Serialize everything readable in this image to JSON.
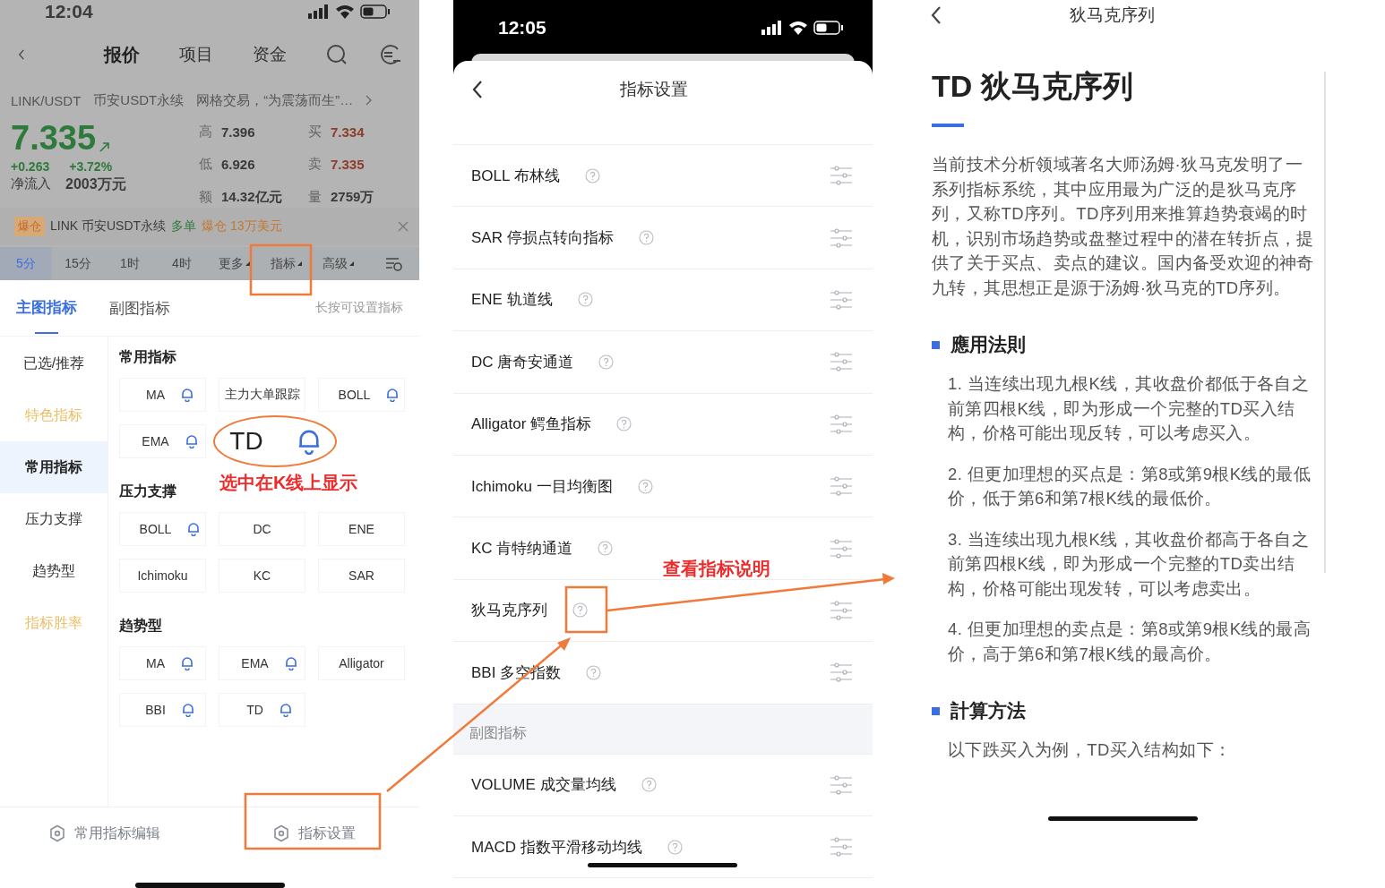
{
  "left_screen": {
    "status_bar": {
      "time": "12:04"
    },
    "nav_tabs": [
      {
        "label": "报价",
        "selected": true
      },
      {
        "label": "项目",
        "selected": false
      },
      {
        "label": "资金",
        "selected": false
      }
    ],
    "ticker": {
      "pair": "LINK/USDT",
      "market": "币安USDT永续",
      "promo": "网格交易，“为震荡而生”…"
    },
    "quote": {
      "price": "7.335",
      "change": "+0.263",
      "change_pct": "+3.72%",
      "net_inflow_label": "净流入",
      "net_inflow": "2003万元",
      "stats": [
        {
          "label": "高",
          "value": "7.396",
          "kind": "plain"
        },
        {
          "label": "买",
          "value": "7.334",
          "kind": "bid"
        },
        {
          "label": "低",
          "value": "6.926",
          "kind": "plain"
        },
        {
          "label": "卖",
          "value": "7.335",
          "kind": "bid"
        },
        {
          "label": "额",
          "value": "14.32亿元",
          "kind": "plain"
        },
        {
          "label": "量",
          "value": "2759万",
          "kind": "plain"
        }
      ]
    },
    "liquidation": {
      "tag": "爆仓",
      "market": "LINK 币安USDT永续",
      "side": "多单",
      "amount": "爆仓 13万美元"
    },
    "periods": [
      {
        "label": "5分",
        "selected": true,
        "dropdown": false
      },
      {
        "label": "15分",
        "selected": false,
        "dropdown": false
      },
      {
        "label": "1时",
        "selected": false,
        "dropdown": false
      },
      {
        "label": "4时",
        "selected": false,
        "dropdown": false
      },
      {
        "label": "更多",
        "selected": false,
        "dropdown": true
      },
      {
        "label": "指标",
        "selected": false,
        "dropdown": true
      },
      {
        "label": "高级",
        "selected": false,
        "dropdown": true
      }
    ],
    "indicator_tabs": [
      {
        "label": "主图指标",
        "selected": true
      },
      {
        "label": "副图指标",
        "selected": false
      }
    ],
    "hint": "长按可设置指标",
    "categories": [
      {
        "label": "已选/推荐",
        "selected": false,
        "kind": "normal"
      },
      {
        "label": "特色指标",
        "selected": false,
        "kind": "special"
      },
      {
        "label": "常用指标",
        "selected": true,
        "kind": "normal"
      },
      {
        "label": "压力支撑",
        "selected": false,
        "kind": "normal"
      },
      {
        "label": "趋势型",
        "selected": false,
        "kind": "normal"
      },
      {
        "label": "指标胜率",
        "selected": false,
        "kind": "special"
      }
    ],
    "groups": [
      {
        "title": "常用指标",
        "chips": [
          {
            "label": "MA",
            "bell": true
          },
          {
            "label": "主力大单跟踪",
            "bell": false
          },
          {
            "label": "BOLL",
            "bell": true
          },
          {
            "label": "EMA",
            "bell": true
          }
        ]
      },
      {
        "title": "压力支撑",
        "chips": [
          {
            "label": "BOLL",
            "bell": true
          },
          {
            "label": "DC",
            "bell": false
          },
          {
            "label": "ENE",
            "bell": false
          },
          {
            "label": "Ichimoku",
            "bell": false
          },
          {
            "label": "KC",
            "bell": false
          },
          {
            "label": "SAR",
            "bell": false
          }
        ]
      },
      {
        "title": "趋势型",
        "chips": [
          {
            "label": "MA",
            "bell": true
          },
          {
            "label": "EMA",
            "bell": true
          },
          {
            "label": "Alligator",
            "bell": false
          },
          {
            "label": "BBI",
            "bell": true
          },
          {
            "label": "TD",
            "bell": true
          }
        ]
      }
    ],
    "footer_buttons": [
      "常用指标编辑",
      "指标设置"
    ]
  },
  "middle_screen": {
    "status_bar": {
      "time": "12:05"
    },
    "title": "指标设置",
    "rows": [
      {
        "kind": "indicator",
        "label": "BOLL 布林线"
      },
      {
        "kind": "indicator",
        "label": "SAR 停损点转向指标"
      },
      {
        "kind": "indicator",
        "label": "ENE 轨道线"
      },
      {
        "kind": "indicator",
        "label": "DC 唐奇安通道"
      },
      {
        "kind": "indicator",
        "label": "Alligator 鳄鱼指标"
      },
      {
        "kind": "indicator",
        "label": "Ichimoku 一目均衡图"
      },
      {
        "kind": "indicator",
        "label": "KC 肯特纳通道"
      },
      {
        "kind": "indicator",
        "label": "狄马克序列"
      },
      {
        "kind": "indicator",
        "label": "BBI 多空指数"
      },
      {
        "kind": "section",
        "label": "副图指标"
      },
      {
        "kind": "indicator",
        "label": "VOLUME 成交量均线"
      },
      {
        "kind": "indicator",
        "label": "MACD 指数平滑移动均线"
      }
    ]
  },
  "right_screen": {
    "title": "狄马克序列",
    "heading": "TD 狄马克序列",
    "intro": "当前技术分析领域著名大师汤姆·狄马克发明了一系列指标系统，其中应用最为广泛的是狄马克序列，又称TD序列。TD序列用来推算趋势衰竭的时机，识别市场趋势或盘整过程中的潜在转折点，提供了关于买点、卖点的建议。国内备受欢迎的神奇九转，其思想正是源于汤姆·狄马克的TD序列。",
    "sections": [
      {
        "title": "應用法則",
        "paragraphs": [
          "1. 当连续出现九根K线，其收盘价都低于各自之前第四根K线，即为形成一个完整的TD买入结构，价格可能出现反转，可以考虑买入。",
          "2. 但更加理想的买点是：第8或第9根K线的最低价，低于第6和第7根K线的最低价。",
          "3. 当连续出现九根K线，其收盘价都高于各自之前第四根K线，即为形成一个完整的TD卖出结构，价格可能出现发转，可以考虑卖出。",
          "4. 但更加理想的卖点是：第8或第9根K线的最高价，高于第6和第7根K线的最高价。"
        ]
      },
      {
        "title": "計算方法",
        "paragraphs": [
          "以下跌买入为例，TD买入结构如下："
        ]
      }
    ]
  },
  "annotations": {
    "callout": {
      "label": "TD"
    },
    "notes": [
      "选中在K线上显示",
      "查看指标说明"
    ]
  }
}
